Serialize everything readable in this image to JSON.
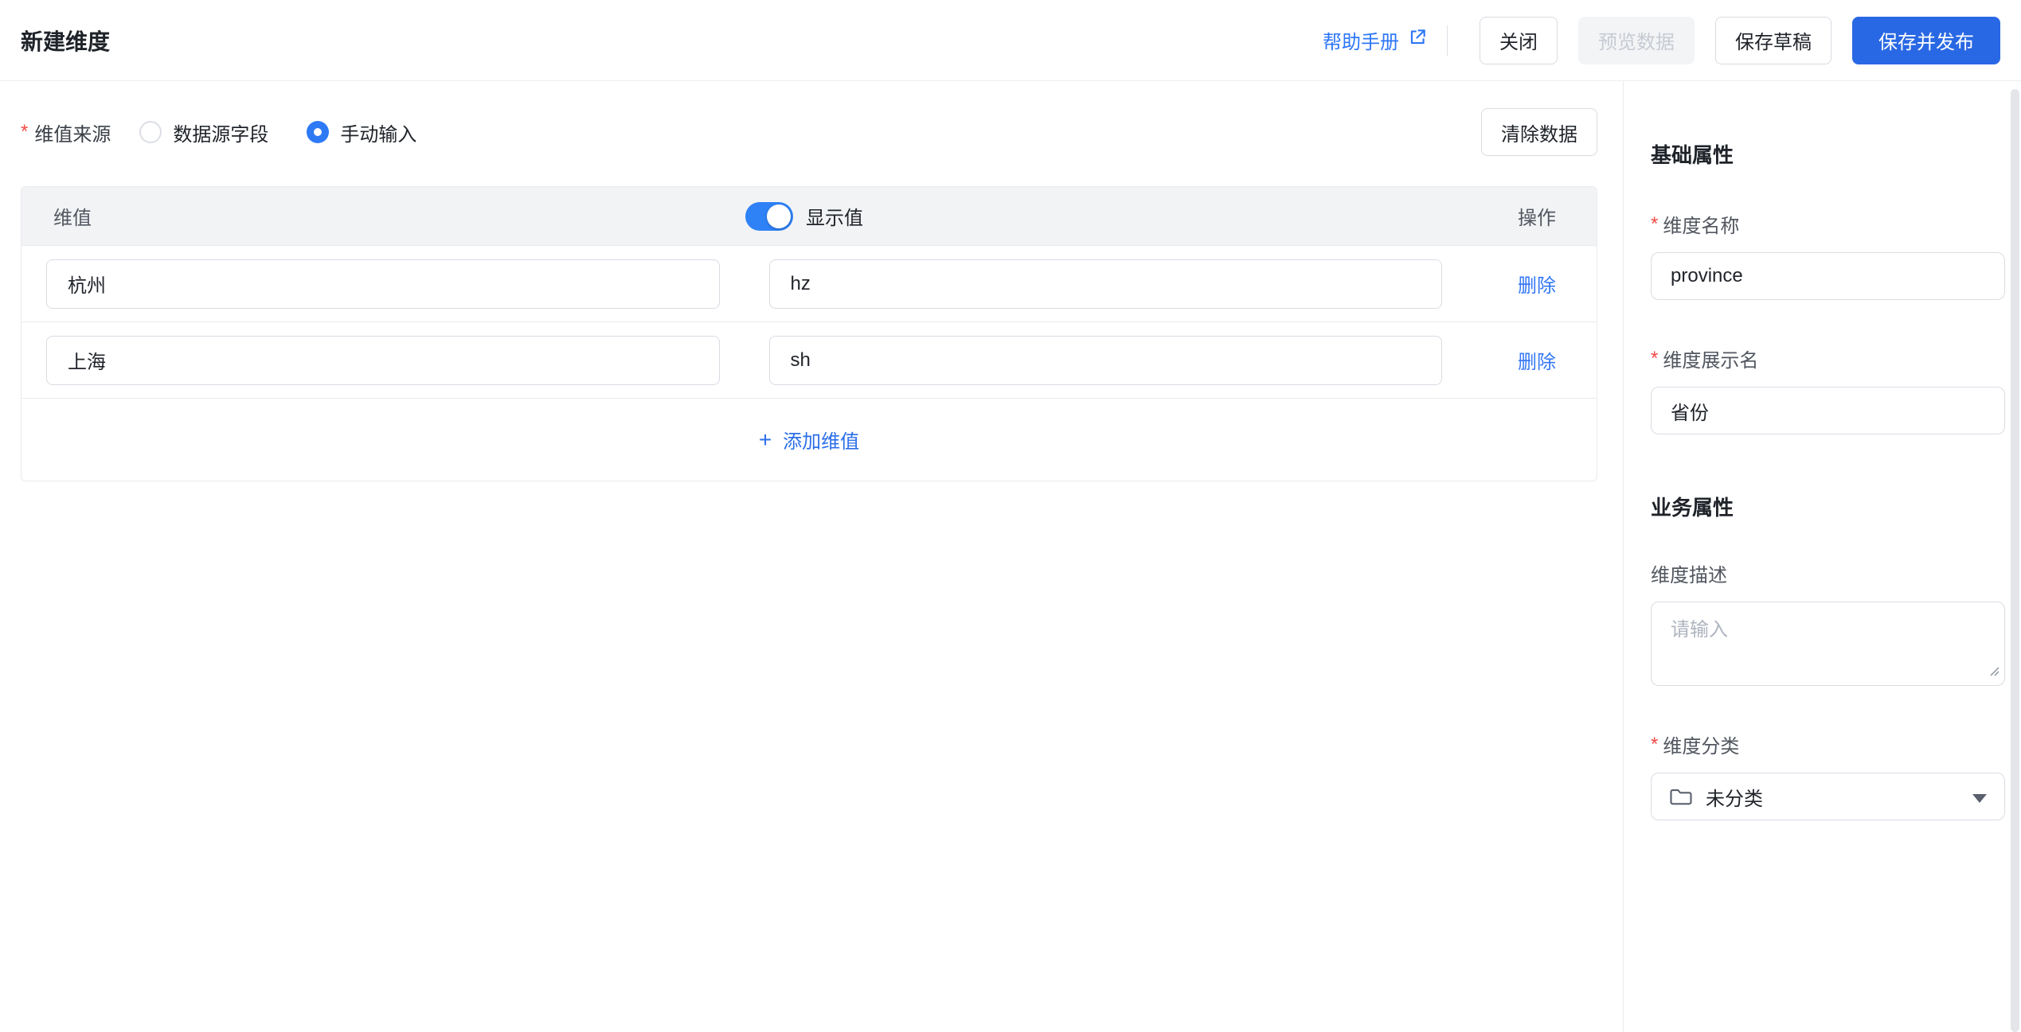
{
  "required_mark": "*",
  "header": {
    "title": "新建维度",
    "help_link": "帮助手册",
    "close_button": "关闭",
    "preview_button": "预览数据",
    "save_draft_button": "保存草稿",
    "save_publish_button": "保存并发布"
  },
  "source": {
    "label": "维值来源",
    "options": [
      {
        "label": "数据源字段",
        "selected": false
      },
      {
        "label": "手动输入",
        "selected": true
      }
    ],
    "clear_button": "清除数据"
  },
  "table": {
    "columns": {
      "value": "维值",
      "display_toggle": "显示值",
      "action": "操作"
    },
    "toggle_on": true,
    "rows": [
      {
        "value": "杭州",
        "display": "hz",
        "action": "删除"
      },
      {
        "value": "上海",
        "display": "sh",
        "action": "删除"
      }
    ],
    "add_plus": "+",
    "add_label": "添加维值"
  },
  "sidebar": {
    "basic_section": "基础属性",
    "name_field": {
      "label": "维度名称",
      "value": "province"
    },
    "display_name_field": {
      "label": "维度展示名",
      "value": "省份"
    },
    "business_section": "业务属性",
    "description_field": {
      "label": "维度描述",
      "placeholder": "请输入",
      "value": ""
    },
    "category_field": {
      "label": "维度分类",
      "value": "未分类"
    }
  },
  "colors": {
    "accent_primary": "#2968e4",
    "link_blue": "#2e77f6",
    "toggle_blue": "#2e82f6",
    "required_red": "#f54a45",
    "border_gray": "#d9dce3",
    "table_header_bg": "#f2f3f5"
  }
}
